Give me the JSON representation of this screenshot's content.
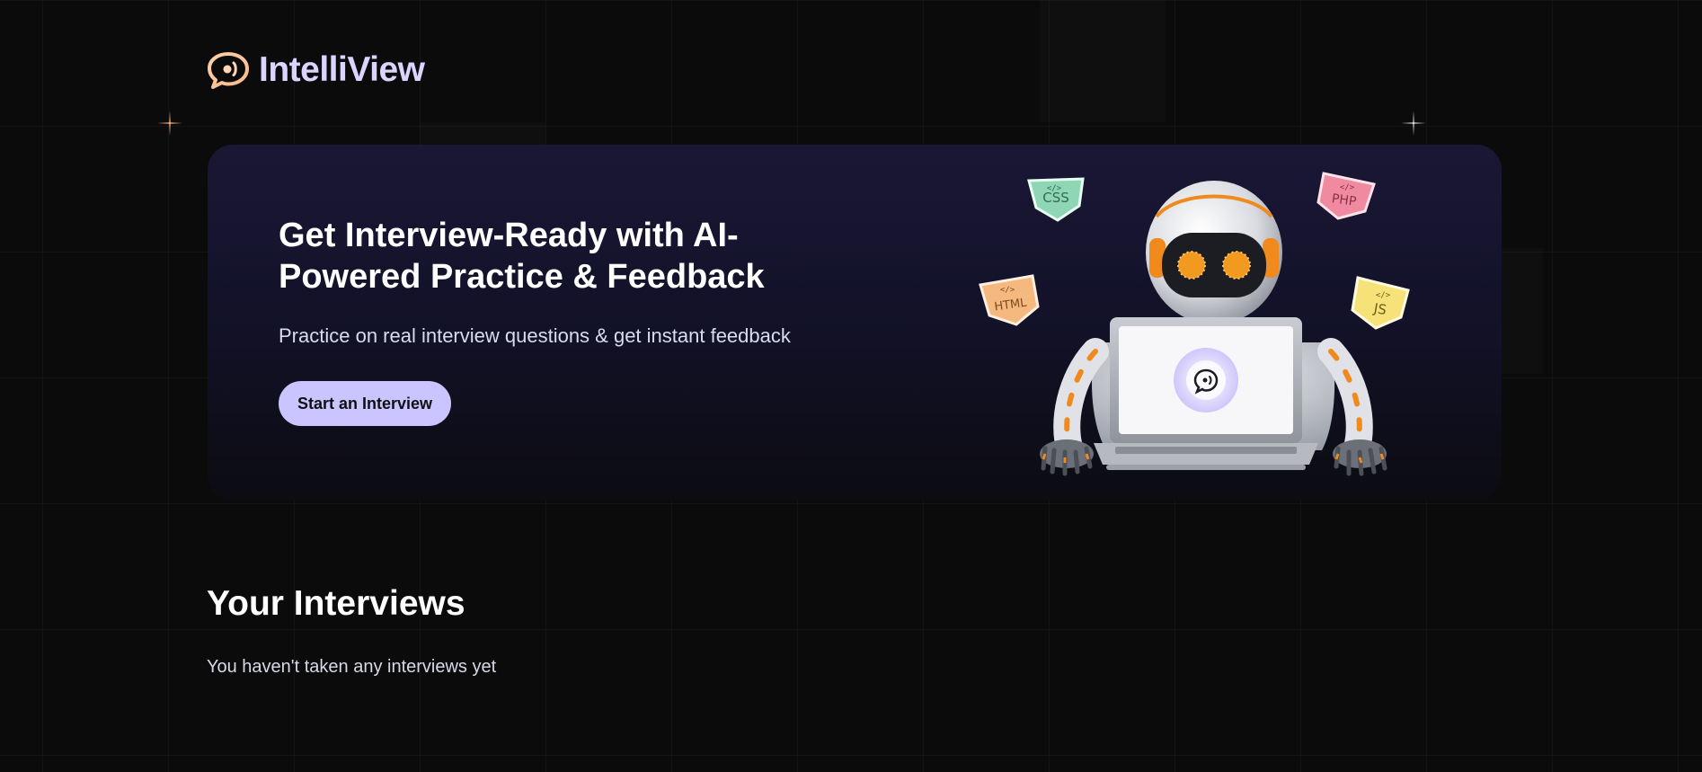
{
  "app": {
    "name": "IntelliView",
    "logo_icon": "chat-bubble-icon",
    "accent_color": "#cac5fe"
  },
  "hero": {
    "title": "Get Interview-Ready with AI-Powered Practice & Feedback",
    "subtitle": "Practice on real interview questions & get instant feedback",
    "cta_label": "Start an Interview",
    "illustration": "robot-with-laptop",
    "tech_badges": [
      "CSS",
      "PHP",
      "HTML",
      "JS"
    ]
  },
  "interviews": {
    "title": "Your Interviews",
    "empty_message": "You haven't taken any interviews yet"
  }
}
